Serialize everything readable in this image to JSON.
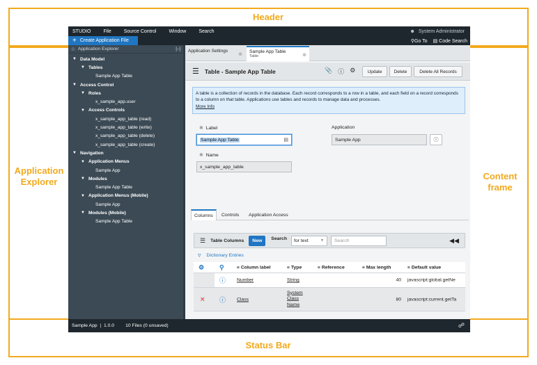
{
  "annotations": {
    "header": "Header",
    "explorer_line1": "Application",
    "explorer_line2": "Explorer",
    "content_line1": "Content",
    "content_line2": "frame",
    "status": "Status Bar",
    "color": "#f2a91d"
  },
  "menubar": {
    "items": [
      "STUDIO",
      "File",
      "Source Control",
      "Window",
      "Search"
    ],
    "user": "System Administrator"
  },
  "toolbar": {
    "create_label": "Create Application File",
    "goto_label": "Go To",
    "code_search_label": "Code Search"
  },
  "explorer": {
    "title": "Application Explorer",
    "collapse": "[–]",
    "tree": [
      {
        "label": "Data Model",
        "bold": true,
        "expanded": true,
        "level": 0
      },
      {
        "label": "Tables",
        "bold": true,
        "expanded": true,
        "level": 1
      },
      {
        "label": "Sample App Table",
        "bold": false,
        "level": 2
      },
      {
        "label": "Access Control",
        "bold": true,
        "expanded": true,
        "level": 0
      },
      {
        "label": "Roles",
        "bold": true,
        "expanded": true,
        "level": 1
      },
      {
        "label": "x_sample_app.user",
        "bold": false,
        "level": 2
      },
      {
        "label": "Access Controls",
        "bold": true,
        "expanded": true,
        "level": 1
      },
      {
        "label": "x_sample_app_table (read)",
        "bold": false,
        "level": 2
      },
      {
        "label": "x_sample_app_table (write)",
        "bold": false,
        "level": 2
      },
      {
        "label": "x_sample_app_table (delete)",
        "bold": false,
        "level": 2
      },
      {
        "label": "x_sample_app_table (create)",
        "bold": false,
        "level": 2
      },
      {
        "label": "Navigation",
        "bold": true,
        "expanded": true,
        "level": 0
      },
      {
        "label": "Application Menus",
        "bold": true,
        "expanded": true,
        "level": 1
      },
      {
        "label": "Sample App",
        "bold": false,
        "level": 2
      },
      {
        "label": "Modules",
        "bold": true,
        "expanded": true,
        "level": 1
      },
      {
        "label": "Sample App Table",
        "bold": false,
        "level": 2
      },
      {
        "label": "Application Menus (Mobile)",
        "bold": true,
        "expanded": true,
        "level": 1
      },
      {
        "label": "Sample App",
        "bold": false,
        "level": 2
      },
      {
        "label": "Modules (Mobile)",
        "bold": true,
        "expanded": true,
        "level": 1
      },
      {
        "label": "Sample App Table",
        "bold": false,
        "level": 2
      }
    ]
  },
  "tabs": [
    {
      "label": "Application Settings",
      "sub": "",
      "active": false
    },
    {
      "label": "Sample App Table",
      "sub": "Table",
      "active": true
    }
  ],
  "form": {
    "title": "Table - Sample App Table",
    "buttons": {
      "update": "Update",
      "delete": "Delete",
      "delete_all": "Delete All Records"
    },
    "info_text": "A table is a collection of records in the database. Each record corresponds to a row in a table, and each field on a record corresponds to a column on that table. Applications use tables and records to manage data and processes.",
    "more_info": "More Info",
    "label_field": {
      "label": "Label",
      "value": "Sample App Table"
    },
    "application_field": {
      "label": "Application",
      "value": "Sample App"
    },
    "name_field": {
      "label": "Name",
      "value": "x_sample_app_table"
    }
  },
  "related_tabs": [
    "Columns",
    "Controls",
    "Application Access"
  ],
  "list": {
    "title": "Table Columns",
    "new_label": "New",
    "search_label": "Search",
    "search_field": "for text",
    "search_placeholder": "Search",
    "filter_label": "Dictionary Entries",
    "columns": [
      "Column label",
      "Type",
      "Reference",
      "Max length",
      "Default value"
    ],
    "rows": [
      {
        "column_label": "Number",
        "type": "String",
        "reference": "",
        "max_length": "40",
        "default_value": "javascript:global.getNe"
      },
      {
        "column_label": "Class",
        "type": "System Class Name",
        "reference": "",
        "max_length": "80",
        "default_value": "javascript:current.getTa"
      }
    ]
  },
  "statusbar": {
    "app": "Sample App  |  1.0.0",
    "files": "10 Files (0 unsaved)"
  }
}
